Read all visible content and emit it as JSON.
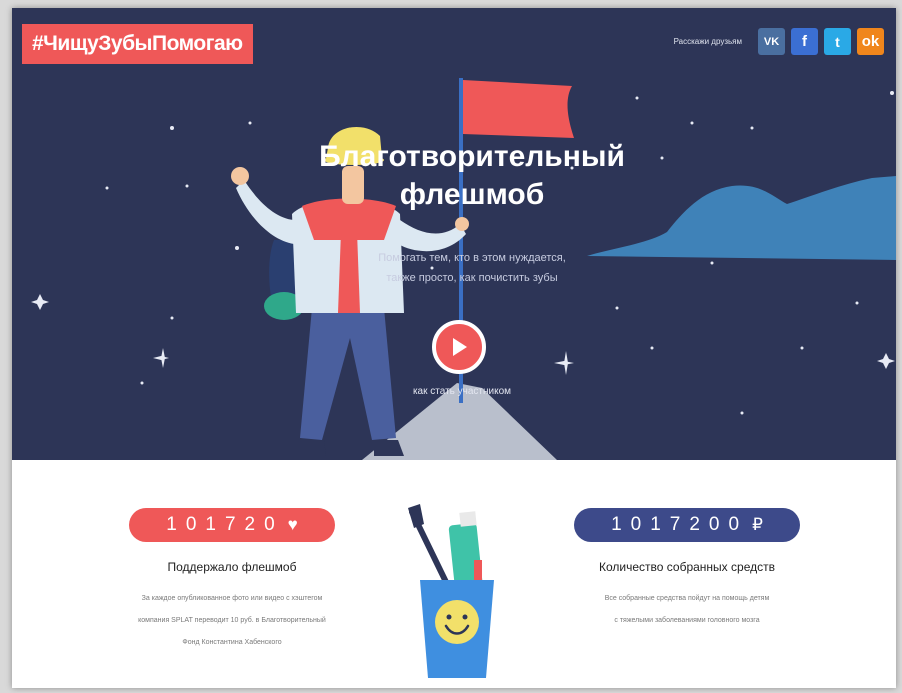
{
  "logo": {
    "text": "#ЧищуЗубыПомогаю"
  },
  "share": {
    "label": "Расскажи друзьям",
    "buttons": [
      {
        "name": "vk-share-button",
        "glyph": "VK",
        "color": "#4a6fa0"
      },
      {
        "name": "facebook-share-button",
        "glyph": "f",
        "color": "#3b6fd3"
      },
      {
        "name": "twitter-share-button",
        "glyph": "t",
        "color": "#2aa9e6"
      },
      {
        "name": "odnoklassniki-share-button",
        "glyph": "ok",
        "color": "#f0861c"
      }
    ]
  },
  "hero": {
    "title_line1": "Благотворительный",
    "title_line2": "флешмоб",
    "subtitle_line1": "Помогать тем, кто в этом нуждается,",
    "subtitle_line2": "также просто, как почистить зубы",
    "cta": "как стать участником",
    "background_color": "#2d3557",
    "accent_color": "#ef5858"
  },
  "stats": [
    {
      "value": "101720",
      "icon": "heart-icon",
      "icon_glyph": "♥",
      "label": "Поддержало флешмоб",
      "desc_line1": "За каждое опубликованное фото или видео с хэштегом",
      "desc_line2": "компания SPLAT переводит 10 руб. в Благотворительный",
      "desc_line3": "Фонд Константина Хабенского"
    },
    {
      "value": "1017200",
      "icon": "ruble-icon",
      "icon_glyph": "₽",
      "label": "Количество собранных средств",
      "desc_line1": "Все собранные средства пойдут на помощь детям",
      "desc_line2": "с тяжелыми заболеваниями головного мозга",
      "desc_line3": ""
    }
  ]
}
